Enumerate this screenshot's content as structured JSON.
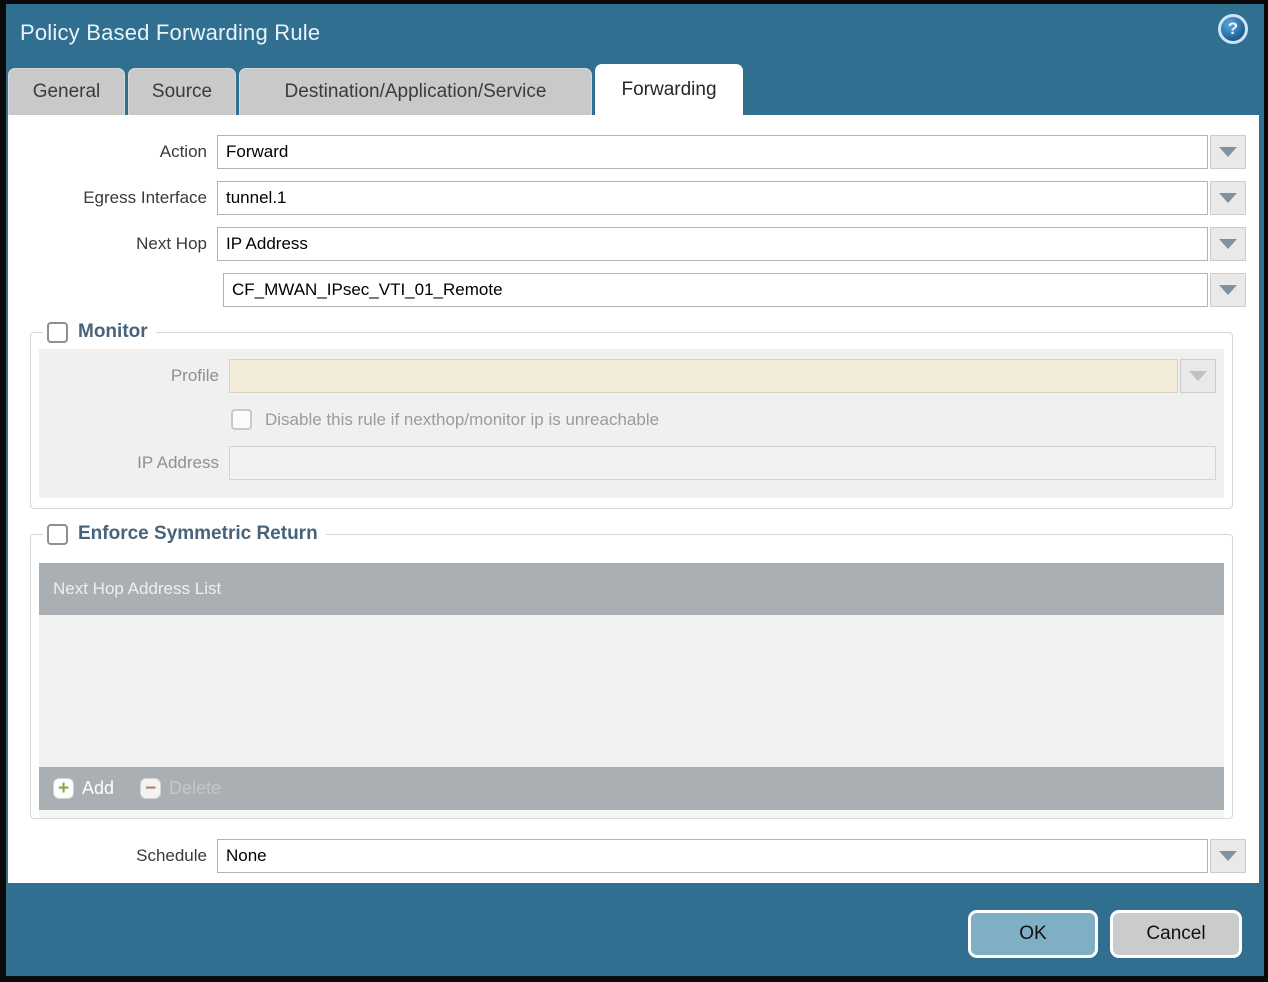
{
  "dialog": {
    "title": "Policy Based Forwarding Rule",
    "help_glyph": "?"
  },
  "tabs": [
    {
      "label": "General",
      "active": false
    },
    {
      "label": "Source",
      "active": false
    },
    {
      "label": "Destination/Application/Service",
      "active": false
    },
    {
      "label": "Forwarding",
      "active": true
    }
  ],
  "form": {
    "action": {
      "label": "Action",
      "value": "Forward"
    },
    "egress_interface": {
      "label": "Egress Interface",
      "value": "tunnel.1"
    },
    "next_hop": {
      "label": "Next Hop",
      "value": "IP Address"
    },
    "next_hop_address": {
      "value": "CF_MWAN_IPsec_VTI_01_Remote"
    },
    "schedule": {
      "label": "Schedule",
      "value": "None"
    }
  },
  "monitor": {
    "title": "Monitor",
    "checked": false,
    "profile": {
      "label": "Profile",
      "value": ""
    },
    "disable_rule": {
      "label": "Disable this rule if nexthop/monitor ip is unreachable",
      "checked": false
    },
    "ip_address": {
      "label": "IP Address",
      "value": ""
    }
  },
  "enforce": {
    "title": "Enforce Symmetric Return",
    "checked": false,
    "list_header": "Next Hop Address List",
    "list_rows": [],
    "add_label": "Add",
    "delete_label": "Delete"
  },
  "footer": {
    "ok_label": "OK",
    "cancel_label": "Cancel"
  },
  "colors": {
    "titlebar_teal": "#316f90",
    "inactive_tab_grey": "#c9c9c9",
    "grid_bar_grey": "#a9afb2",
    "grid_body_grey": "#f0f1f1",
    "panel_grey": "#f0f0f0",
    "profile_cream": "#f2ecd9",
    "legend_slate": "#49637b",
    "ok_blue": "#7fafc5",
    "cancel_grey": "#c9cbcd",
    "add_green": "#85a93c",
    "delete_red": "#b37d6d"
  }
}
